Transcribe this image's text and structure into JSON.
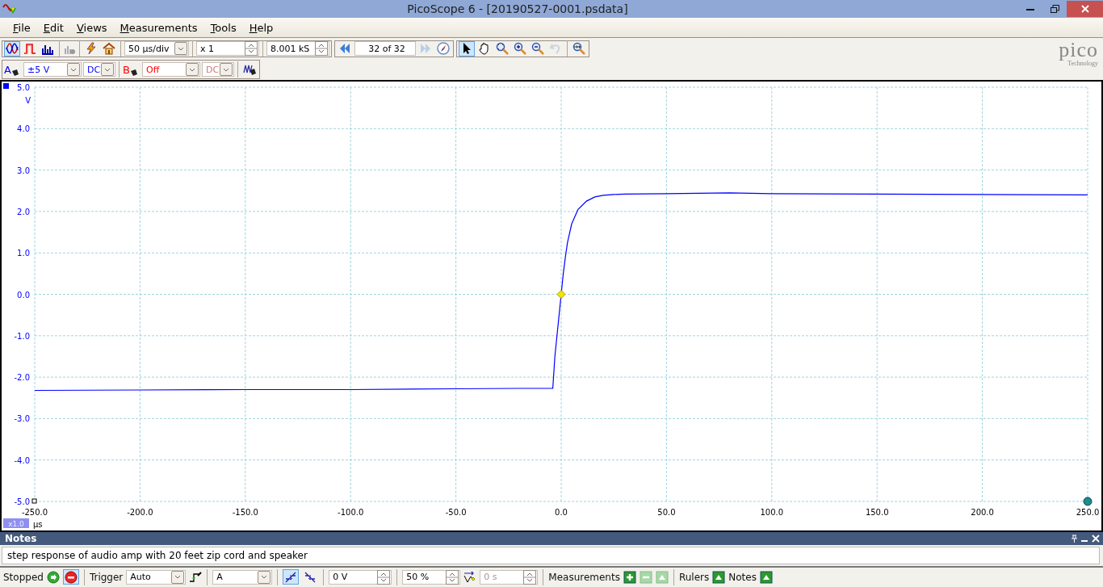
{
  "window": {
    "title": "PicoScope 6 - [20190527-0001.psdata]"
  },
  "menu": [
    "File",
    "Edit",
    "Views",
    "Measurements",
    "Tools",
    "Help"
  ],
  "toolbar": {
    "views": [
      {
        "kind": "scope",
        "selected": true
      },
      {
        "kind": "persistence",
        "selected": false
      },
      {
        "kind": "spectrum",
        "selected": false
      }
    ],
    "timebase": "50 µs/div",
    "multiplier": "x 1",
    "samples": "8.001 kS",
    "buffer": "32 of 32",
    "tools": [
      {
        "kind": "pointer",
        "selected": true,
        "disabled": false
      },
      {
        "kind": "hand",
        "selected": false,
        "disabled": false
      },
      {
        "kind": "zoom-fit",
        "selected": false,
        "disabled": false
      },
      {
        "kind": "zoom-in",
        "selected": false,
        "disabled": false
      },
      {
        "kind": "zoom-out",
        "selected": false,
        "disabled": false
      },
      {
        "kind": "undo",
        "selected": false,
        "disabled": true
      },
      {
        "kind": "zoom-100",
        "selected": false,
        "disabled": false
      }
    ]
  },
  "channels": [
    {
      "label": "A",
      "range": "±5 V",
      "coupling": "DC",
      "enabled": true,
      "color": "#0000ff"
    },
    {
      "label": "B",
      "range": "Off",
      "coupling": "DC",
      "enabled": false,
      "color": "#ff0000"
    }
  ],
  "logo": {
    "name": "pico",
    "tagline": "Technology"
  },
  "scope": {
    "zoom_badge": "x1.0",
    "chart_data": {
      "type": "line",
      "xlabel": "µs",
      "ylabel": "V",
      "xlim": [
        -250,
        250
      ],
      "ylim": [
        -5,
        5
      ],
      "xticks": [
        {
          "value": -250,
          "label": "-250.0"
        },
        {
          "value": -200,
          "label": "-200.0"
        },
        {
          "value": -150,
          "label": "-150.0"
        },
        {
          "value": -100,
          "label": "-100.0"
        },
        {
          "value": -50,
          "label": "-50.0"
        },
        {
          "value": 0,
          "label": "0.0"
        },
        {
          "value": 50,
          "label": "50.0"
        },
        {
          "value": 100,
          "label": "100.0"
        },
        {
          "value": 150,
          "label": "150.0"
        },
        {
          "value": 200,
          "label": "200.0"
        },
        {
          "value": 250,
          "label": "250.0"
        }
      ],
      "yticks": [
        {
          "value": 5,
          "label": "5.0"
        },
        {
          "value": 4,
          "label": "4.0"
        },
        {
          "value": 3,
          "label": "3.0"
        },
        {
          "value": 2,
          "label": "2.0"
        },
        {
          "value": 1,
          "label": "1.0"
        },
        {
          "value": 0,
          "label": "0.0"
        },
        {
          "value": -1,
          "label": "-1.0"
        },
        {
          "value": -2,
          "label": "-2.0"
        },
        {
          "value": -3,
          "label": "-3.0"
        },
        {
          "value": -4,
          "label": "-4.0"
        },
        {
          "value": -5,
          "label": "-5.0"
        }
      ],
      "x": [
        -250,
        -200,
        -150,
        -100,
        -50,
        -20,
        -4,
        -3,
        -2,
        -1,
        0,
        1,
        2,
        3,
        5,
        8,
        12,
        16,
        20,
        25,
        30,
        50,
        80,
        100,
        150,
        200,
        250
      ],
      "grid": true,
      "series": [
        {
          "color": "#0000ff",
          "values": [
            -2.32,
            -2.31,
            -2.3,
            -2.3,
            -2.28,
            -2.27,
            -2.27,
            -1.5,
            -1.0,
            -0.5,
            0,
            0.5,
            0.9,
            1.25,
            1.7,
            2.05,
            2.25,
            2.35,
            2.39,
            2.41,
            2.42,
            2.43,
            2.45,
            2.43,
            2.42,
            2.41,
            2.4
          ]
        }
      ]
    }
  },
  "notes": {
    "title": "Notes",
    "value": "step response of audio amp with 20 feet zip cord and speaker"
  },
  "status": {
    "state": "Stopped",
    "trigger_label": "Trigger",
    "trigger_mode": "Auto",
    "source": "A",
    "edges": [
      {
        "kind": "rising",
        "selected": true
      },
      {
        "kind": "falling",
        "selected": false
      }
    ],
    "threshold": "0 V",
    "pre_trigger": "50 %",
    "delay": "0 s",
    "delay_enabled": false,
    "measurements_label": "Measurements",
    "rulers_label": "Rulers",
    "notes_label": "Notes"
  }
}
